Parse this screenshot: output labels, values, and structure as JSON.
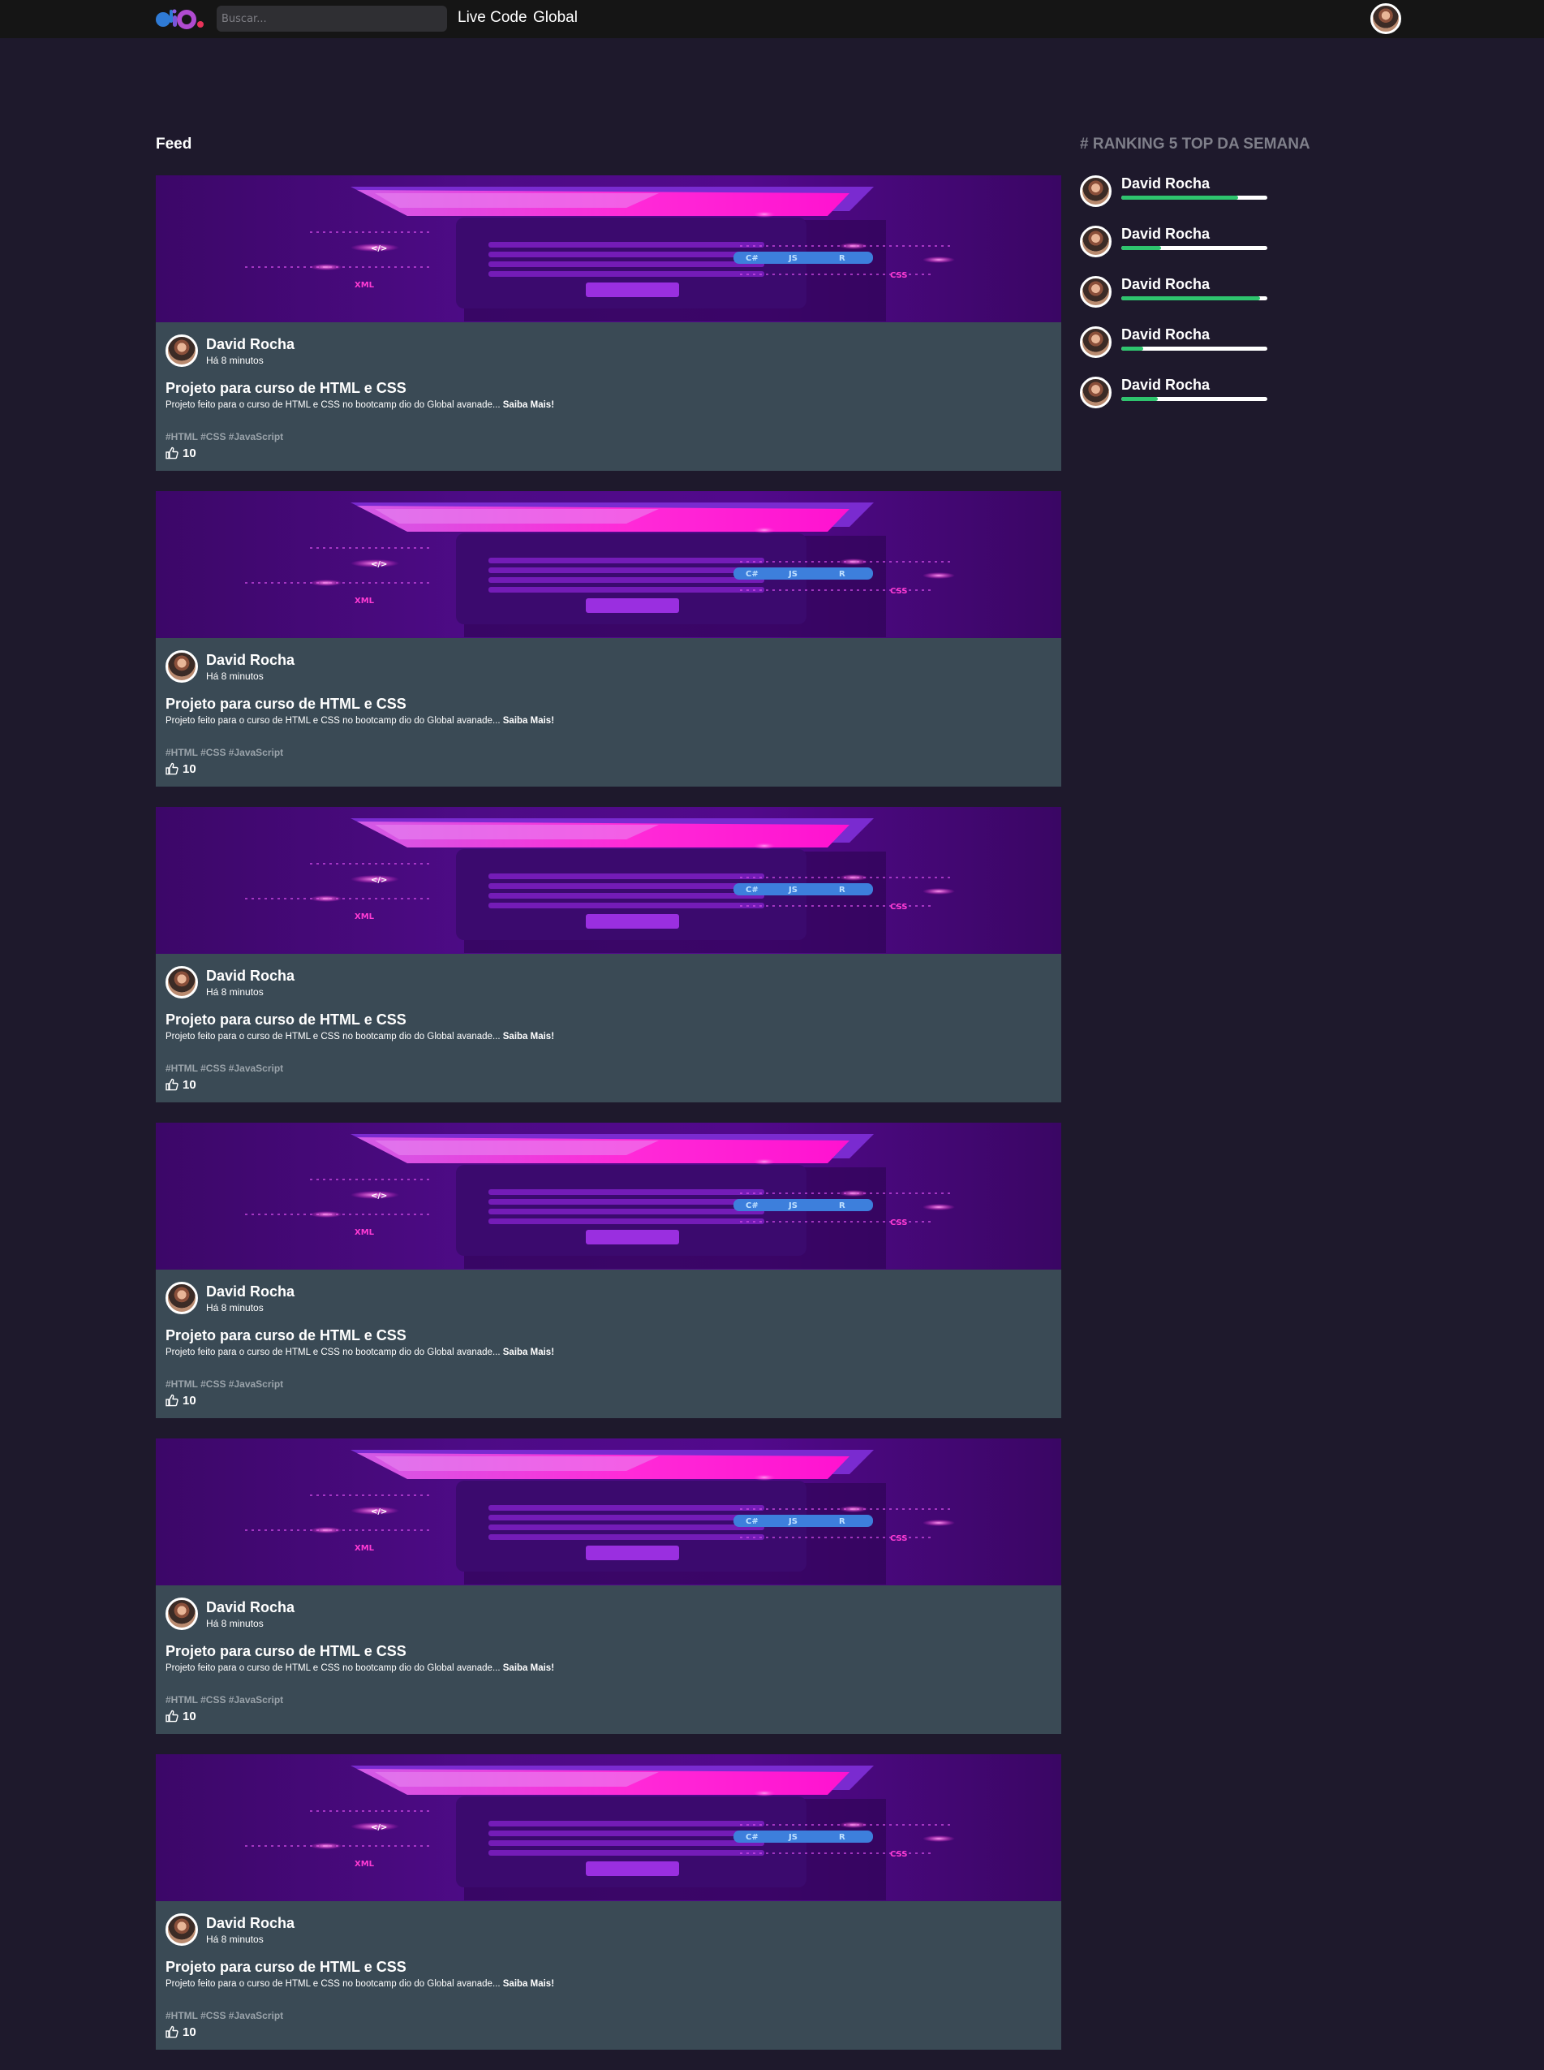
{
  "header": {
    "logo_alt": "dio",
    "search_placeholder": "Buscar...",
    "nav": [
      {
        "label": "Live Code"
      },
      {
        "label": "Global"
      }
    ]
  },
  "feed": {
    "title": "Feed",
    "posts": [
      {
        "author": "David Rocha",
        "time": "Há 8 minutos",
        "title": "Projeto para curso de HTML e CSS",
        "description": "Projeto feito para o curso de HTML e CSS no bootcamp dio do Global avanade...",
        "read_more": "Saiba Mais!",
        "tags": "#HTML #CSS #JavaScript",
        "likes": "10"
      },
      {
        "author": "David Rocha",
        "time": "Há 8 minutos",
        "title": "Projeto para curso de HTML e CSS",
        "description": "Projeto feito para o curso de HTML e CSS no bootcamp dio do Global avanade...",
        "read_more": "Saiba Mais!",
        "tags": "#HTML #CSS #JavaScript",
        "likes": "10"
      },
      {
        "author": "David Rocha",
        "time": "Há 8 minutos",
        "title": "Projeto para curso de HTML e CSS",
        "description": "Projeto feito para o curso de HTML e CSS no bootcamp dio do Global avanade...",
        "read_more": "Saiba Mais!",
        "tags": "#HTML #CSS #JavaScript",
        "likes": "10"
      },
      {
        "author": "David Rocha",
        "time": "Há 8 minutos",
        "title": "Projeto para curso de HTML e CSS",
        "description": "Projeto feito para o curso de HTML e CSS no bootcamp dio do Global avanade...",
        "read_more": "Saiba Mais!",
        "tags": "#HTML #CSS #JavaScript",
        "likes": "10"
      },
      {
        "author": "David Rocha",
        "time": "Há 8 minutos",
        "title": "Projeto para curso de HTML e CSS",
        "description": "Projeto feito para o curso de HTML e CSS no bootcamp dio do Global avanade...",
        "read_more": "Saiba Mais!",
        "tags": "#HTML #CSS #JavaScript",
        "likes": "10"
      },
      {
        "author": "David Rocha",
        "time": "Há 8 minutos",
        "title": "Projeto para curso de HTML e CSS",
        "description": "Projeto feito para o curso de HTML e CSS no bootcamp dio do Global avanade...",
        "read_more": "Saiba Mais!",
        "tags": "#HTML #CSS #JavaScript",
        "likes": "10"
      }
    ]
  },
  "banner_text": {
    "xml": "XML",
    "css": "CSS",
    "chips": [
      "C#",
      "JS",
      "R"
    ],
    "code": "</>"
  },
  "ranking": {
    "title": "# RANKING 5 TOP DA SEMANA",
    "items": [
      {
        "name": "David Rocha",
        "progress": 0.8
      },
      {
        "name": "David Rocha",
        "progress": 0.27
      },
      {
        "name": "David Rocha",
        "progress": 0.95
      },
      {
        "name": "David Rocha",
        "progress": 0.15
      },
      {
        "name": "David Rocha",
        "progress": 0.25
      }
    ]
  },
  "colors": {
    "background": "#1e192c",
    "header": "#151515",
    "card_body": "#3a4a55",
    "progress_fill": "#2ec46e",
    "banner_purple": "#4d0b86",
    "banner_pink": "#ff1fd6"
  }
}
